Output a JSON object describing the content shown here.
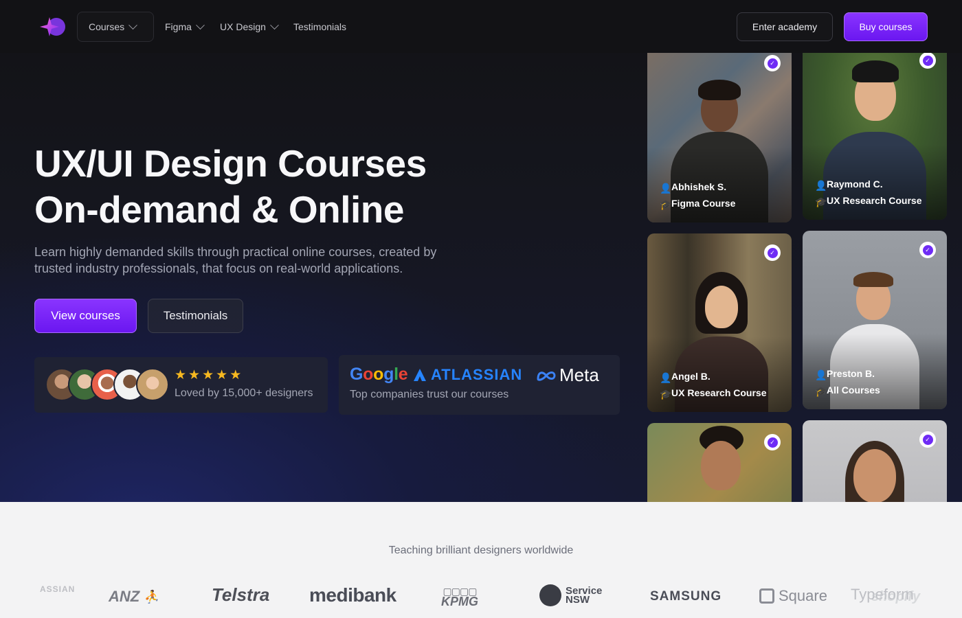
{
  "nav": {
    "courses_label": "Courses",
    "figma_label": "Figma",
    "uxdesign_label": "UX Design",
    "testimonials_label": "Testimonials",
    "enter_label": "Enter academy",
    "buy_label": "Buy courses"
  },
  "hero": {
    "title_line1": "UX/UI Design Courses",
    "title_line2": "On-demand & Online",
    "subtitle": "Learn highly demanded skills through practical online courses, created by trusted industry professionals, that focus on real-world applications.",
    "view_courses": "View courses",
    "testimonials": "Testimonials",
    "loved_by": "Loved by 15,000+ designers",
    "rating_stars": 5,
    "companies_caption": "Top companies trust our courses",
    "companies": [
      "Google",
      "ATLASSIAN",
      "Meta"
    ]
  },
  "testimonials": [
    {
      "name": "Abhishek S.",
      "course": "Figma Course"
    },
    {
      "name": "Raymond C.",
      "course": "UX Research Course"
    },
    {
      "name": "Angel B.",
      "course": "UX Research Course"
    },
    {
      "name": "Preston B.",
      "course": "All Courses"
    }
  ],
  "brands_section": {
    "heading": "Teaching brilliant designers worldwide",
    "brands": [
      "ASSIAN",
      "ANZ",
      "Telstra",
      "medibank",
      "KPMG",
      "Service NSW",
      "SAMSUNG",
      "Square",
      "Typeform",
      "shopify"
    ]
  },
  "colors": {
    "accent": "#7a26f7",
    "star": "#f6b820",
    "hero_bg": "#121215",
    "card_bg": "#1f2233"
  }
}
